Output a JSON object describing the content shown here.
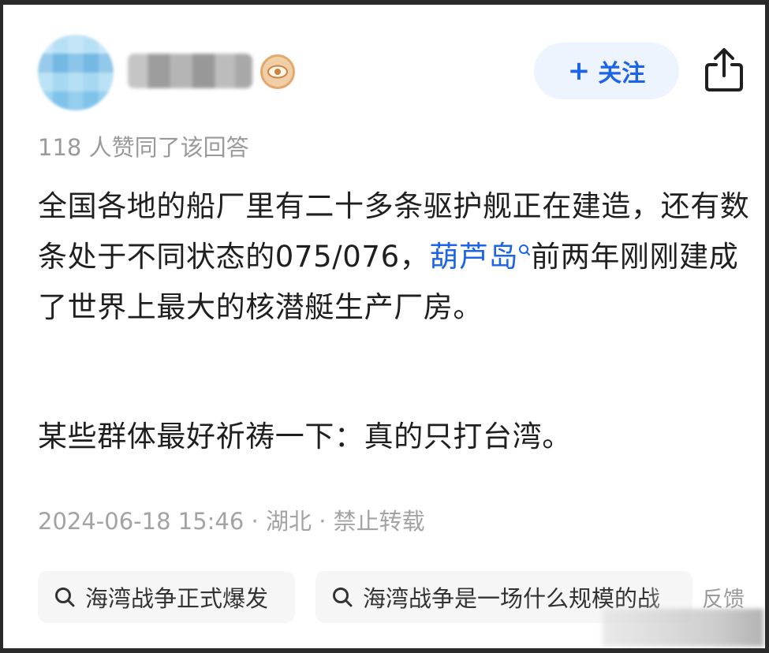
{
  "header": {
    "follow_label": "关注",
    "follow_plus": "+"
  },
  "answer": {
    "likes_text": "118 人赞同了该回答",
    "para1_part1": "全国各地的船厂里有二十多条驱护舰正在建造，还有数条处于不同状态的075/076，",
    "para1_link": "葫芦岛",
    "para1_part2": "前两年刚刚建成了世界上最大的核潜艇生产厂房。",
    "para2": "某些群体最好祈祷一下：真的只打台湾。",
    "meta": "2024-06-18 15:46 · 湖北 · 禁止转载"
  },
  "related_searches": [
    {
      "label": "海湾战争正式爆发"
    },
    {
      "label": "海湾战争是一场什么规模的战"
    }
  ],
  "feedback_label": "反馈",
  "icons": {
    "share": "share-icon",
    "search": "search-icon",
    "badge": "eye-badge-icon"
  },
  "colors": {
    "accent": "#1e64e6",
    "follow_bg": "#eef4fd",
    "muted_text": "#9a9a9a",
    "body_text": "#1f1f1f",
    "badge": "#e4a86b"
  }
}
